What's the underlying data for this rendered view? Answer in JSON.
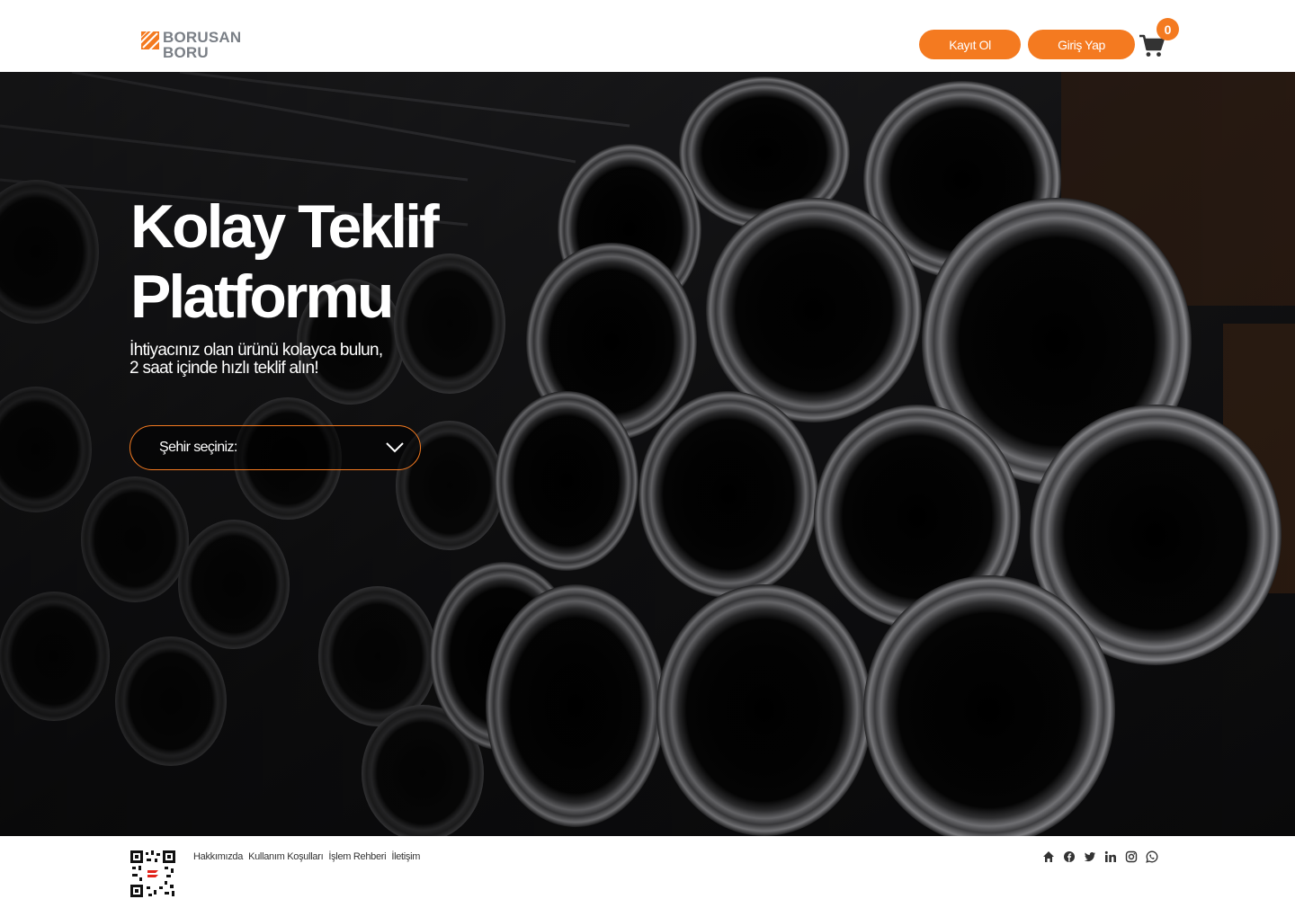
{
  "header": {
    "logo_line1": "BORUSAN",
    "logo_line2": "BORU",
    "register_label": "Kayıt Ol",
    "login_label": "Giriş Yap",
    "cart_icon": "shopping-cart-icon",
    "cart_count": "0"
  },
  "hero": {
    "title": "Kolay Teklif Platformu",
    "subtitle": "İhtiyacınız olan ürünü kolayca bulun, 2 saat içinde hızlı teklif alın!",
    "city_select_label": "Şehir seçiniz:",
    "city_select_icon": "chevron-down-icon"
  },
  "footer": {
    "links": [
      "Hakkımızda",
      "Kullanım Koşulları",
      "İşlem Rehberi",
      "İletişim"
    ],
    "social_icons": [
      "home-icon",
      "facebook-icon",
      "twitter-icon",
      "linkedin-icon",
      "instagram-icon",
      "whatsapp-icon"
    ]
  },
  "colors": {
    "accent": "#f47a20",
    "logo_gray": "#7a7f86",
    "hero_bg": "#0b0b0c"
  }
}
